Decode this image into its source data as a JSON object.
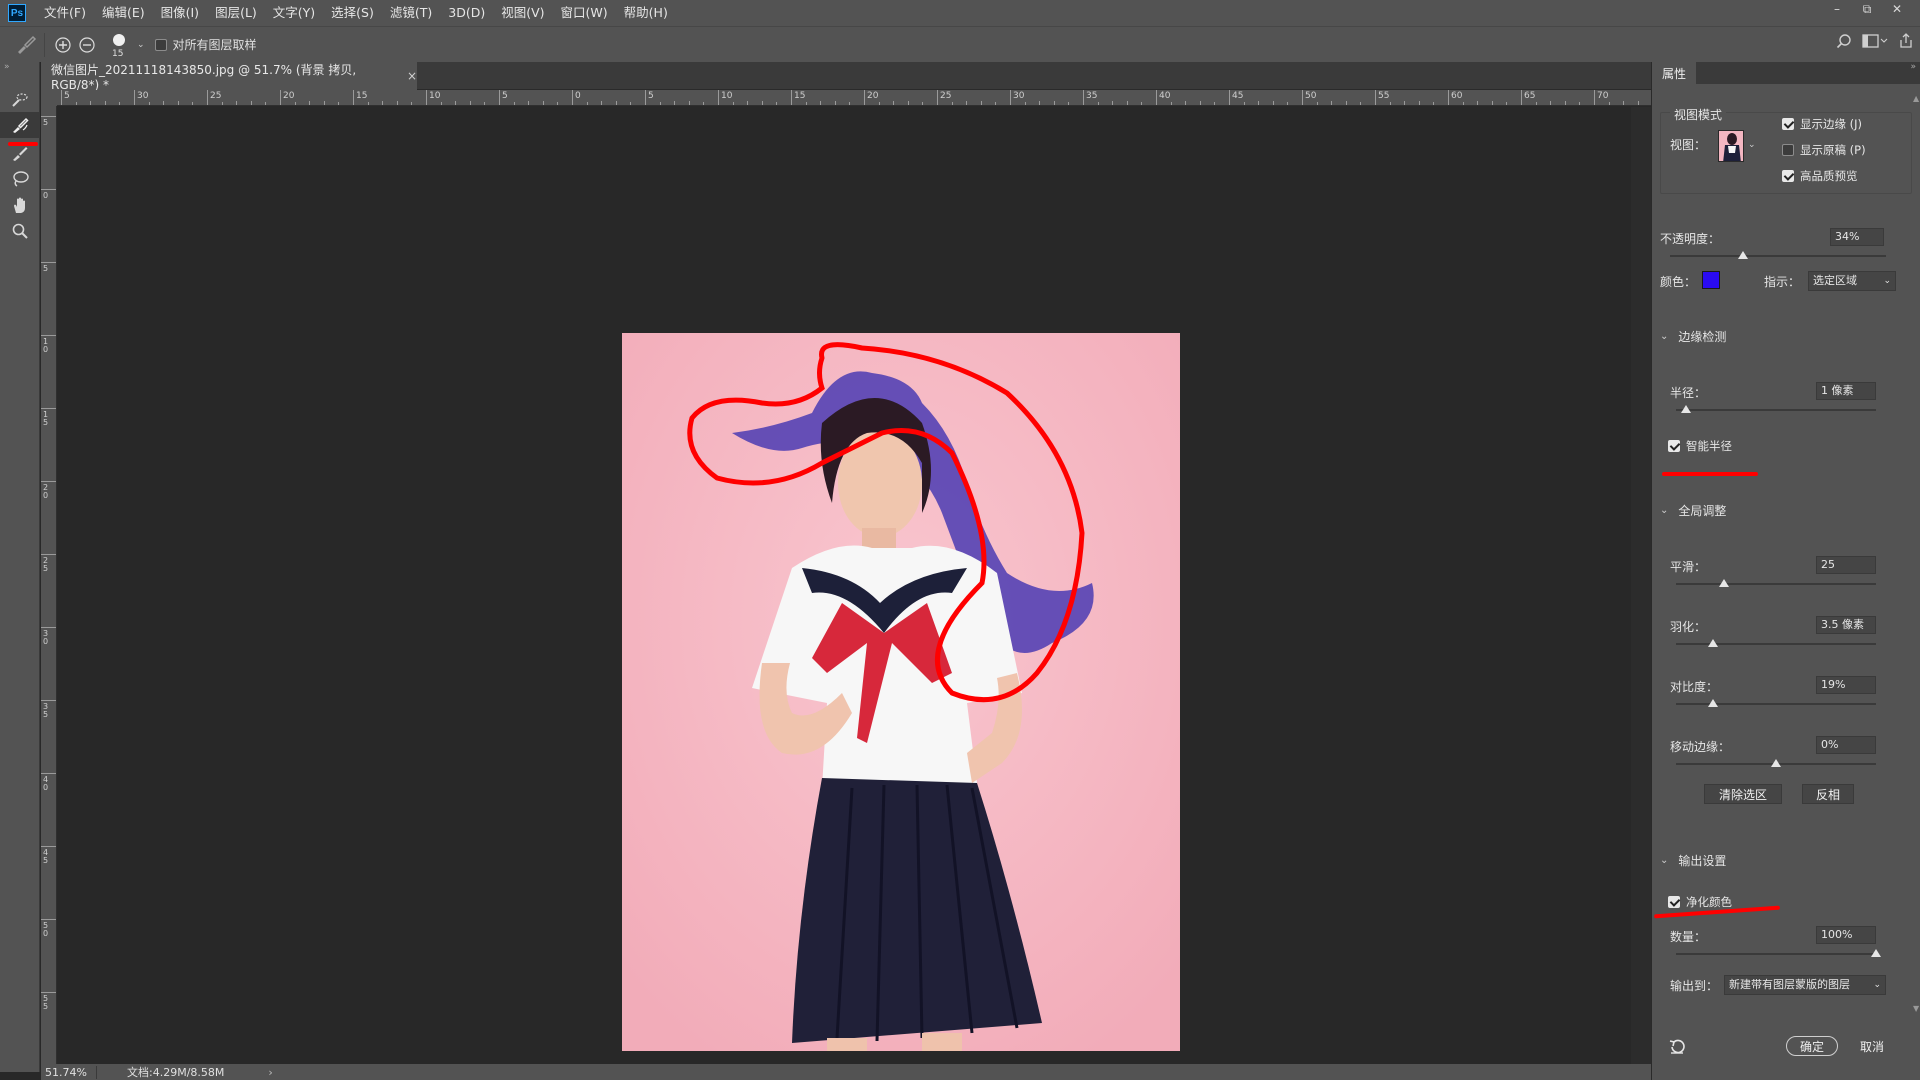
{
  "app": {
    "logo": "Ps"
  },
  "menu": [
    "文件(F)",
    "编辑(E)",
    "图像(I)",
    "图层(L)",
    "文字(Y)",
    "选择(S)",
    "滤镜(T)",
    "3D(D)",
    "视图(V)",
    "窗口(W)",
    "帮助(H)"
  ],
  "window_controls": {
    "minimize": "–",
    "restore": "⧉",
    "close": "✕"
  },
  "options": {
    "brush_size": "15",
    "sample_all_label": "对所有图层取样"
  },
  "document": {
    "tab_title": "微信图片_20211118143850.jpg @ 51.7% (背景 拷贝, RGB/8*) *",
    "close": "×"
  },
  "ruler": {
    "top_labels": [
      "5",
      "30",
      "25",
      "20",
      "15",
      "10",
      "5",
      "0",
      "5",
      "10",
      "15",
      "20",
      "25",
      "30",
      "35",
      "40",
      "45",
      "50",
      "55",
      "60",
      "65",
      "70"
    ],
    "left_labels": [
      "5",
      "0",
      "5",
      "10",
      "15",
      "20",
      "25",
      "30",
      "35",
      "40",
      "45",
      "50",
      "55"
    ]
  },
  "status": {
    "zoom": "51.74%",
    "doc": "文档:4.29M/8.58M",
    "arrow": "›"
  },
  "properties": {
    "tab": "属性",
    "view_mode": {
      "title": "视图模式",
      "view_label": "视图：",
      "show_edge": "显示边缘 (J)",
      "show_original": "显示原稿 (P)",
      "high_quality": "高品质预览"
    },
    "opacity": {
      "label": "不透明度：",
      "value": "34%",
      "fraction": 0.34
    },
    "color": {
      "label": "颜色：",
      "hex": "#2a0bf2"
    },
    "indicate": {
      "label": "指示：",
      "value": "选定区域"
    },
    "edge_detection": {
      "title": "边缘检测",
      "radius_label": "半径：",
      "radius_value": "1 像素",
      "smart_radius": "智能半径"
    },
    "global": {
      "title": "全局调整",
      "smooth_label": "平滑：",
      "smooth_value": "25",
      "feather_label": "羽化：",
      "feather_value": "3.5 像素",
      "contrast_label": "对比度：",
      "contrast_value": "19%",
      "shift_label": "移动边缘：",
      "shift_value": "0%",
      "clear_btn": "清除选区",
      "invert_btn": "反相"
    },
    "output": {
      "title": "输出设置",
      "decontaminate": "净化颜色",
      "amount_label": "数量：",
      "amount_value": "100%",
      "output_to_label": "输出到：",
      "output_to_value": "新建带有图层蒙版的图层"
    },
    "ok": "确定",
    "cancel": "取消"
  },
  "colors": {
    "panel": "#535353",
    "canvas": "#282828",
    "accent_red": "#ff0000",
    "overlay_blue": "#2a0bf2"
  }
}
